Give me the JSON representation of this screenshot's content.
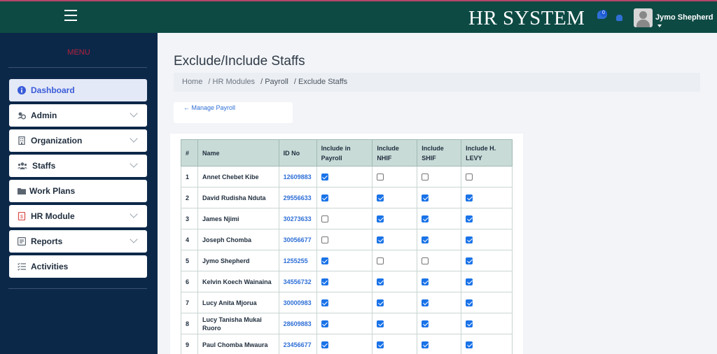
{
  "header": {
    "brand": "HR SYSTEM",
    "notification_count": "0",
    "user_name": "Jymo Shepherd"
  },
  "sidebar": {
    "menu_title": "MENU",
    "items": [
      {
        "label": "Dashboard",
        "icon": "info-circle-icon",
        "active": true,
        "expandable": false
      },
      {
        "label": "Admin",
        "icon": "users-cog-icon",
        "active": false,
        "expandable": true
      },
      {
        "label": "Organization",
        "icon": "building-icon",
        "active": false,
        "expandable": true
      },
      {
        "label": "Staffs",
        "icon": "users-icon",
        "active": false,
        "expandable": true
      },
      {
        "label": "Work Plans",
        "icon": "folder-icon",
        "active": false,
        "expandable": false
      },
      {
        "label": "HR Module",
        "icon": "file-dollar-icon",
        "active": false,
        "expandable": true
      },
      {
        "label": "Reports",
        "icon": "report-icon",
        "active": false,
        "expandable": true
      },
      {
        "label": "Activities",
        "icon": "list-check-icon",
        "active": false,
        "expandable": false
      }
    ]
  },
  "main": {
    "page_title": "Exclude/Include Staffs",
    "breadcrumb": [
      "Home",
      "/ HR Modules",
      "/ Payroll",
      "/ Exclude Staffs"
    ],
    "manage_link": "← Manage Payroll"
  },
  "table": {
    "headers": [
      "#",
      "Name",
      "ID No",
      "Include in Payroll",
      "Include NHIF",
      "Include SHIF",
      "Include H. LEVY"
    ],
    "rows": [
      {
        "n": "1",
        "name": "Annet Chebet Kibe",
        "id": "12609883",
        "payroll": true,
        "nhif": false,
        "shif": false,
        "levy": false
      },
      {
        "n": "2",
        "name": "David Rudisha Nduta",
        "id": "29556633",
        "payroll": true,
        "nhif": true,
        "shif": true,
        "levy": true
      },
      {
        "n": "3",
        "name": "James Njimi",
        "id": "30273633",
        "payroll": false,
        "nhif": true,
        "shif": true,
        "levy": true
      },
      {
        "n": "4",
        "name": "Joseph Chomba",
        "id": "30056677",
        "payroll": false,
        "nhif": true,
        "shif": true,
        "levy": true
      },
      {
        "n": "5",
        "name": "Jymo Shepherd",
        "id": "1255255",
        "payroll": true,
        "nhif": false,
        "shif": false,
        "levy": true
      },
      {
        "n": "6",
        "name": "Kelvin Koech Wainaina",
        "id": "34556732",
        "payroll": true,
        "nhif": true,
        "shif": true,
        "levy": true
      },
      {
        "n": "7",
        "name": "Lucy Anita Mjorua",
        "id": "30000983",
        "payroll": true,
        "nhif": true,
        "shif": true,
        "levy": true
      },
      {
        "n": "8",
        "name": "Lucy Tanisha Mukai Ruoro",
        "id": "28609883",
        "payroll": true,
        "nhif": true,
        "shif": true,
        "levy": true
      },
      {
        "n": "9",
        "name": "Paul Chomba Mwaura",
        "id": "23456677",
        "payroll": true,
        "nhif": true,
        "shif": true,
        "levy": true
      }
    ]
  }
}
